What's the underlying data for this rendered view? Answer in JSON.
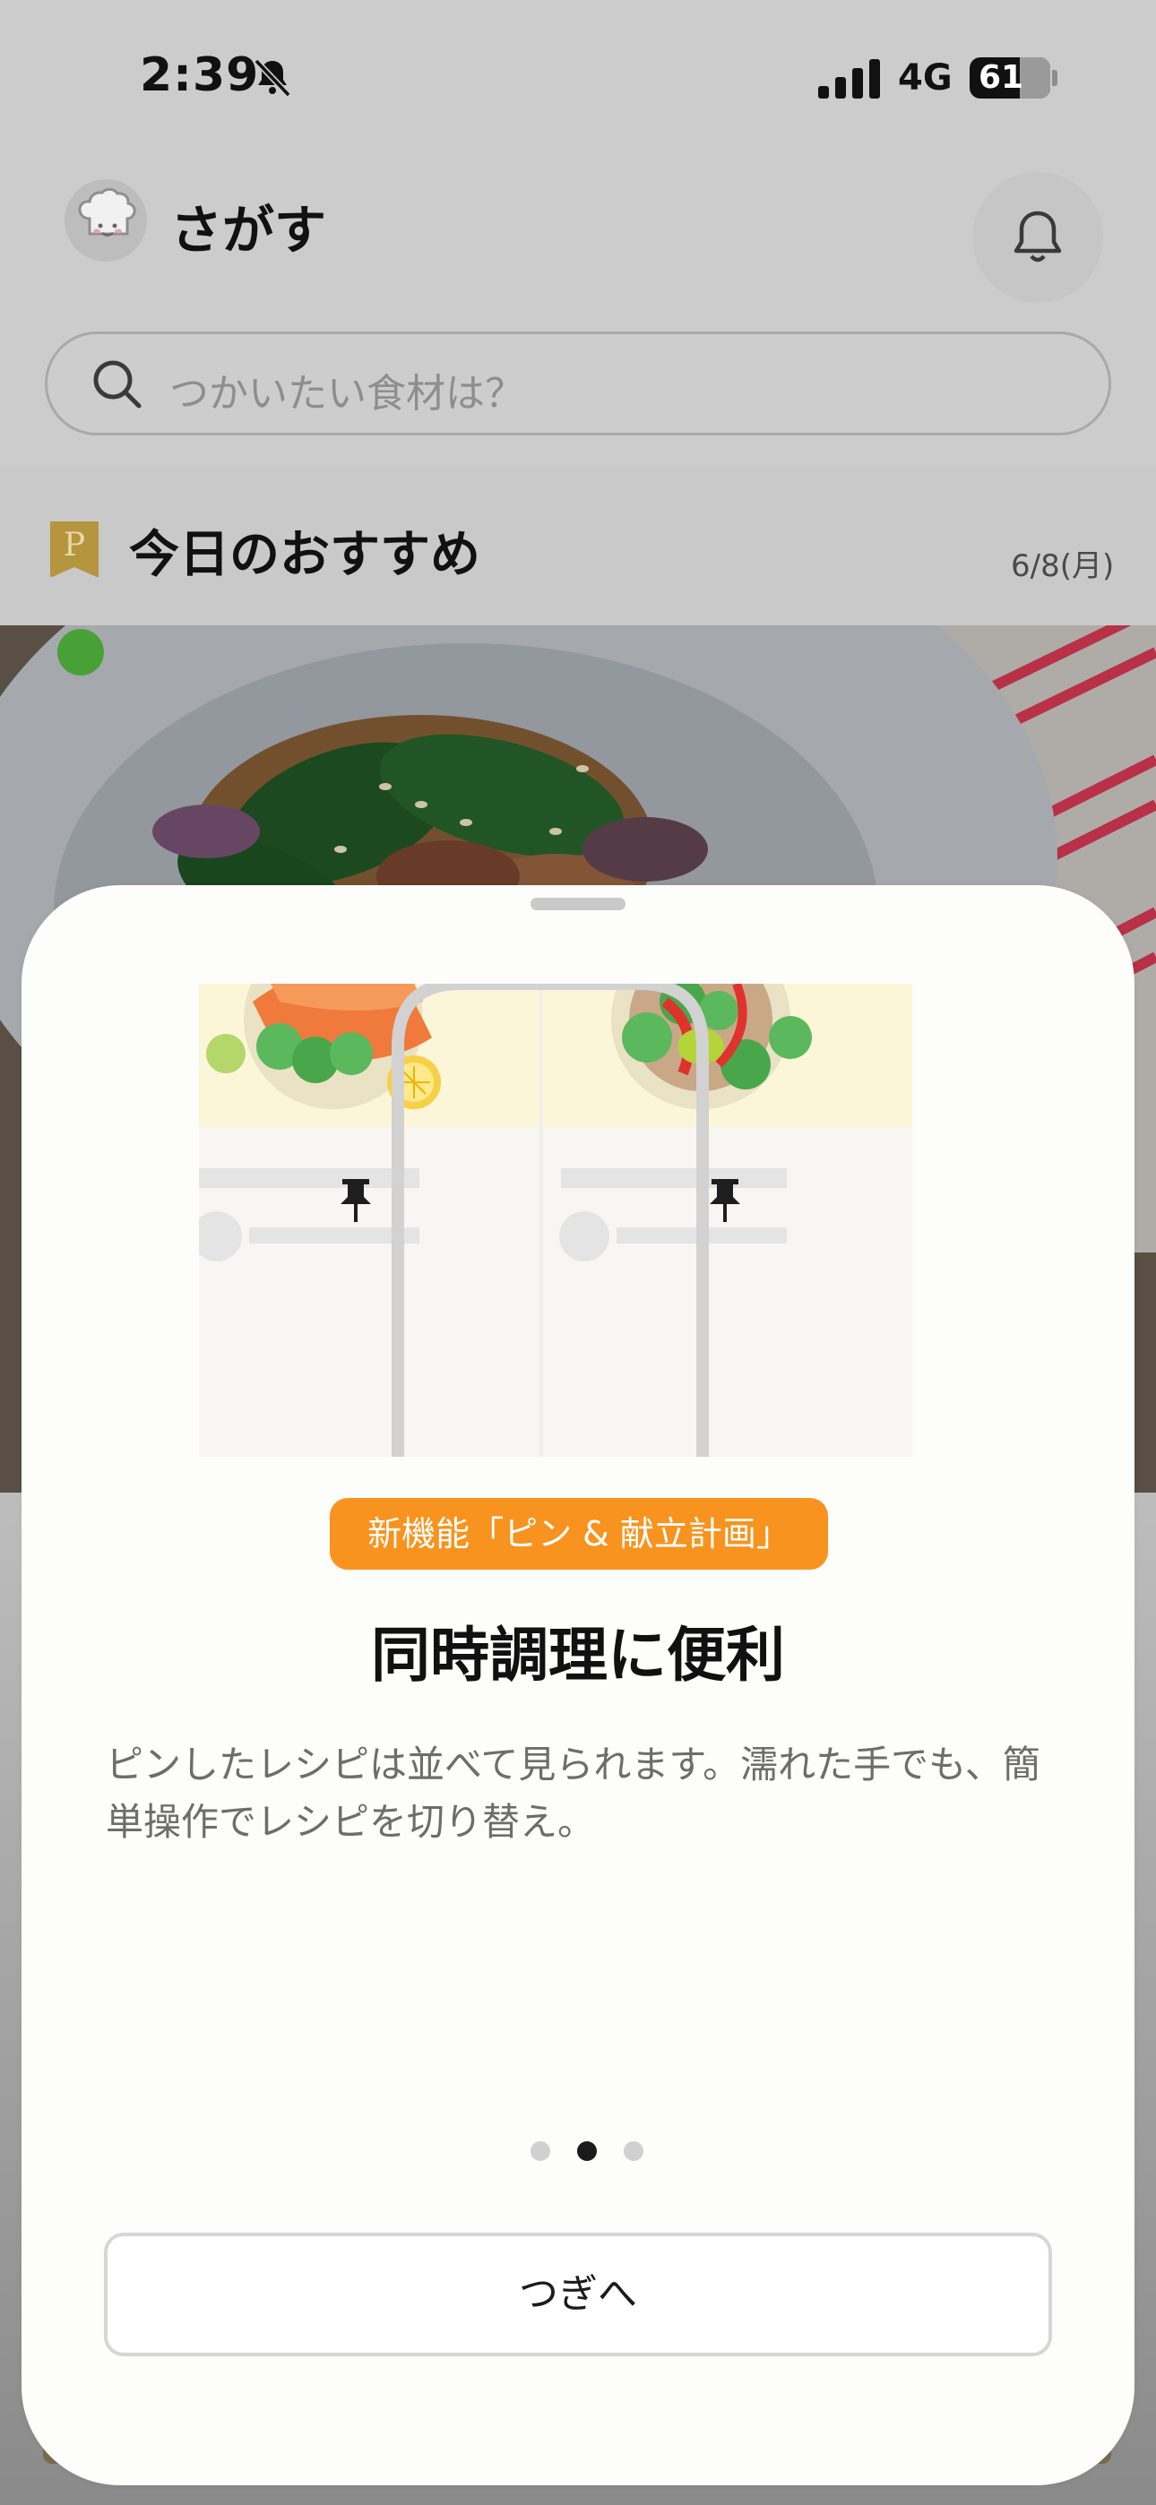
{
  "status_bar": {
    "time": "2:39",
    "network": "4G",
    "battery": "61",
    "icons": [
      "bell-slash-icon",
      "signal-icon",
      "battery-icon"
    ]
  },
  "header": {
    "title": "さがす",
    "avatar_icon": "chef-icon",
    "notification_icon": "bell-icon"
  },
  "search": {
    "placeholder": "つかいたい食材は？"
  },
  "today": {
    "badge_letter": "P",
    "title": "今日のおすすめ",
    "date": "6/8(月)"
  },
  "sheet": {
    "badge": "新機能「ピン & 献立計画」",
    "title": "同時調理に便利",
    "description": "ピンしたレシピは並べて見られます。濡れた手でも、簡単操作でレシピを切り替え。",
    "pages": {
      "total": 3,
      "current": 2
    },
    "next_label": "つぎへ"
  },
  "colors": {
    "accent": "#f7931e",
    "badge_gold": "#b6953f",
    "sheet_bg": "#fdfdfb"
  }
}
